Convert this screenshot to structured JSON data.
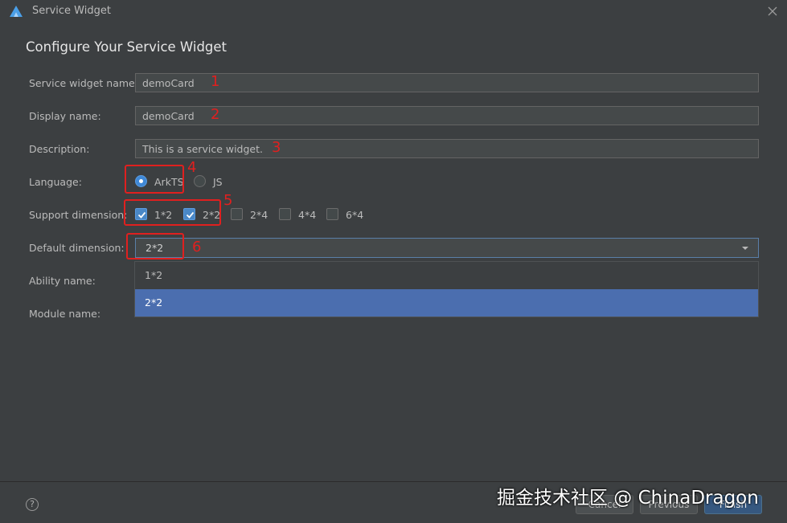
{
  "window": {
    "title": "Service Widget"
  },
  "heading": "Configure Your Service Widget",
  "form": {
    "service_widget_name": {
      "label": "Service widget name:",
      "value": "demoCard"
    },
    "display_name": {
      "label": "Display name:",
      "value": "demoCard"
    },
    "description": {
      "label": "Description:",
      "value": "This is a service widget."
    },
    "language": {
      "label": "Language:",
      "options": [
        "ArkTS",
        "JS"
      ],
      "selected": "ArkTS"
    },
    "support_dimension": {
      "label": "Support dimension:",
      "options": [
        {
          "label": "1*2",
          "checked": true
        },
        {
          "label": "2*2",
          "checked": true
        },
        {
          "label": "2*4",
          "checked": false
        },
        {
          "label": "4*4",
          "checked": false
        },
        {
          "label": "6*4",
          "checked": false
        }
      ]
    },
    "default_dimension": {
      "label": "Default dimension:",
      "value": "2*2",
      "dropdown_options": [
        "1*2",
        "2*2"
      ],
      "highlighted": "2*2"
    },
    "ability_name": {
      "label": "Ability name:"
    },
    "module_name": {
      "label": "Module name:"
    }
  },
  "annotations": [
    "1",
    "2",
    "3",
    "4",
    "5",
    "6"
  ],
  "footer": {
    "help": "?",
    "cancel": "Cancel",
    "previous": "Previous",
    "finish": "Finish"
  },
  "watermark": "掘金技术社区 @ ChinaDragon",
  "colors": {
    "annotation": "#e0201f",
    "selection": "#4b6eaf",
    "accent": "#4a88c7",
    "background": "#3c3f41"
  }
}
